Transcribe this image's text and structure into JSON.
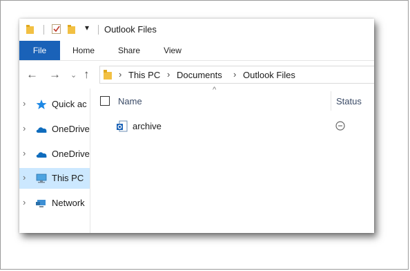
{
  "window": {
    "title": "Outlook Files"
  },
  "ribbon": {
    "tabs": [
      {
        "label": "File",
        "active": true
      },
      {
        "label": "Home"
      },
      {
        "label": "Share"
      },
      {
        "label": "View"
      }
    ]
  },
  "address": {
    "crumbs": [
      "This PC",
      "Documents",
      "Outlook Files"
    ]
  },
  "navpane": {
    "items": [
      {
        "label": "Quick ac",
        "icon": "star-icon",
        "selected": false
      },
      {
        "label": "OneDrive",
        "icon": "cloud-icon",
        "selected": false
      },
      {
        "label": "OneDrive",
        "icon": "cloud-icon",
        "selected": false
      },
      {
        "label": "This PC",
        "icon": "computer-icon",
        "selected": true
      },
      {
        "label": "Network",
        "icon": "network-icon",
        "selected": false
      }
    ]
  },
  "content": {
    "columns": {
      "name": "Name",
      "status": "Status"
    },
    "files": [
      {
        "name": "archive",
        "icon": "outlook-data-file-icon",
        "status_icon": "minus-circle-icon"
      }
    ]
  },
  "colors": {
    "file_tab": "#1a62b8",
    "selected_nav": "#cce8ff",
    "folder": "#f2c043",
    "cloud": "#0f6cbd"
  }
}
